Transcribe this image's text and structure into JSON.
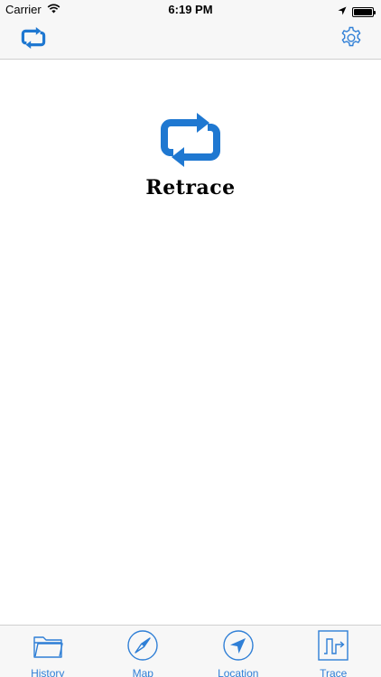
{
  "status_bar": {
    "carrier": "Carrier",
    "time": "6:19 PM",
    "battery_percent": 100
  },
  "nav_bar": {
    "left_icon": "retrace-logo-icon",
    "right_icon": "gear-icon"
  },
  "hero": {
    "icon": "retrace-logo-icon",
    "title": "Retrace"
  },
  "tab_bar": {
    "items": [
      {
        "label": "History",
        "icon": "folder-icon"
      },
      {
        "label": "Map",
        "icon": "compass-icon"
      },
      {
        "label": "Location",
        "icon": "location-arrow-icon"
      },
      {
        "label": "Trace",
        "icon": "trace-path-icon"
      }
    ]
  },
  "colors": {
    "accent": "#2f7fd6",
    "bar_background": "#f7f7f7"
  }
}
